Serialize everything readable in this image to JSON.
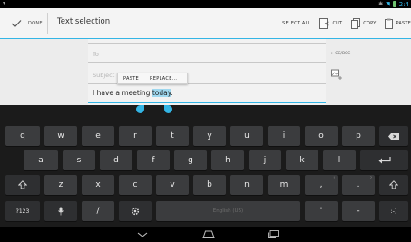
{
  "status_bar": {
    "time": "2:4"
  },
  "action_bar": {
    "done_label": "DONE",
    "title": "Text selection",
    "actions": {
      "select_all": "SELECT ALL",
      "cut": "CUT",
      "copy": "COPY",
      "paste": "PASTE"
    }
  },
  "compose": {
    "to_placeholder": "To",
    "cc_bcc": "+ CC/BCC",
    "subject_placeholder": "Subject",
    "body_before": "I have a meeting ",
    "body_selected": "today",
    "body_after": "."
  },
  "context_menu": {
    "paste": "PASTE",
    "replace": "REPLACE..."
  },
  "keyboard": {
    "row1": [
      "q",
      "w",
      "e",
      "r",
      "t",
      "y",
      "u",
      "i",
      "o",
      "p"
    ],
    "row2": [
      "a",
      "s",
      "d",
      "f",
      "g",
      "h",
      "j",
      "k",
      "l"
    ],
    "row3": [
      "z",
      "x",
      "c",
      "v",
      "b",
      "n",
      "m",
      ",",
      "."
    ],
    "row1_hints": [
      "",
      "",
      "",
      "",
      "",
      "",
      "",
      "",
      "",
      ""
    ],
    "symbols_key": "?123",
    "slash_key": "/",
    "space_label": "English (US)",
    "apostrophe_key": "'",
    "dash_key": "-",
    "smiley_key": ":-)",
    "comma_hint": "!",
    "period_hint": "?"
  },
  "colors": {
    "accent": "#33b5e5",
    "key": "#3b3c3e",
    "keyboard_bg": "#1b1b1b"
  }
}
